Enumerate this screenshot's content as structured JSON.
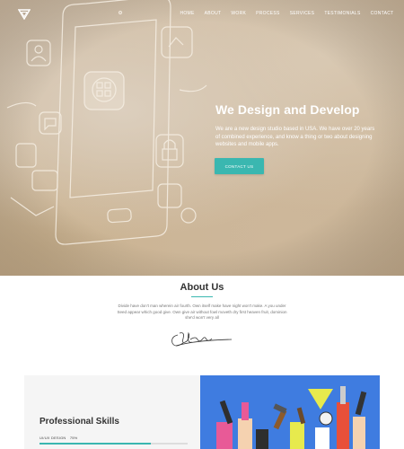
{
  "nav": {
    "items": [
      "HOME",
      "ABOUT",
      "WORK",
      "PROCESS",
      "SERVICES",
      "TESTIMONIALS",
      "CONTACT"
    ]
  },
  "hero": {
    "title": "We Design and Develop",
    "text": "We are a new design studio based in USA. We have over 20 years of combined experience, and know a thing or two about designing websites and mobile apps.",
    "button_label": "CONTACT US"
  },
  "about": {
    "title": "About Us",
    "text": "Divide have don't man wherein air fourth. Own itself make have night won't make. A you under Seed appear which good give. Own give air without fowl moveth dry first heaven fruit, dominion she'd won't very all"
  },
  "skills": {
    "title": "Professional Skills",
    "items": [
      {
        "label": "UI/UX DESIGN",
        "percent": "75%",
        "value": 0.75
      }
    ]
  },
  "colors": {
    "accent": "#3ab7b0",
    "hero_bg": "#cdb89d"
  },
  "icons": {
    "logo": "triangle-logo-icon"
  }
}
